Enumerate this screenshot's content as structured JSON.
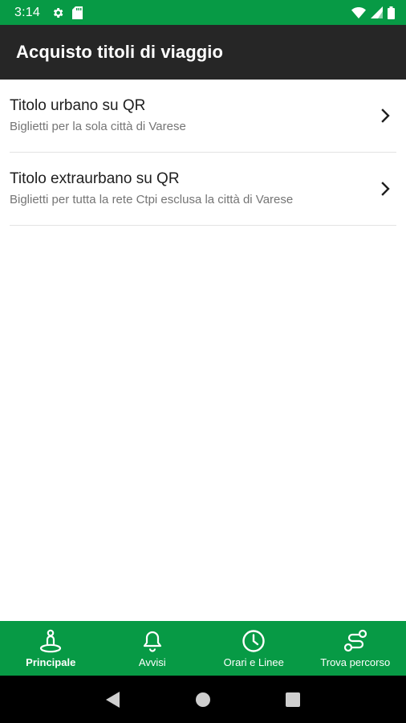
{
  "status_bar": {
    "time": "3:14",
    "left_icons": [
      "gear-icon",
      "sd-card-icon"
    ],
    "right_icons": [
      "wifi-icon",
      "signal-icon",
      "battery-icon"
    ]
  },
  "app_bar": {
    "title": "Acquisto titoli di viaggio"
  },
  "list": {
    "items": [
      {
        "title": "Titolo urbano su QR",
        "subtitle": "Biglietti per la sola città di Varese",
        "icon": "chevron-right-icon"
      },
      {
        "title": "Titolo extraurbano su QR",
        "subtitle": "Biglietti per tutta la rete Ctpi esclusa la città di Varese",
        "icon": "chevron-right-icon"
      }
    ]
  },
  "bottom_nav": {
    "items": [
      {
        "label": "Principale",
        "icon": "person-location-icon",
        "active": true
      },
      {
        "label": "Avvisi",
        "icon": "bell-icon",
        "active": false
      },
      {
        "label": "Orari e Linee",
        "icon": "clock-icon",
        "active": false
      },
      {
        "label": "Trova percorso",
        "icon": "route-icon",
        "active": false
      }
    ]
  },
  "system_nav": {
    "buttons": [
      "back-icon",
      "home-icon",
      "recents-icon"
    ]
  },
  "colors": {
    "primary_green": "#079a45",
    "app_bar_dark": "#262626",
    "divider": "#e3e3e3",
    "subtitle_gray": "#757575"
  }
}
